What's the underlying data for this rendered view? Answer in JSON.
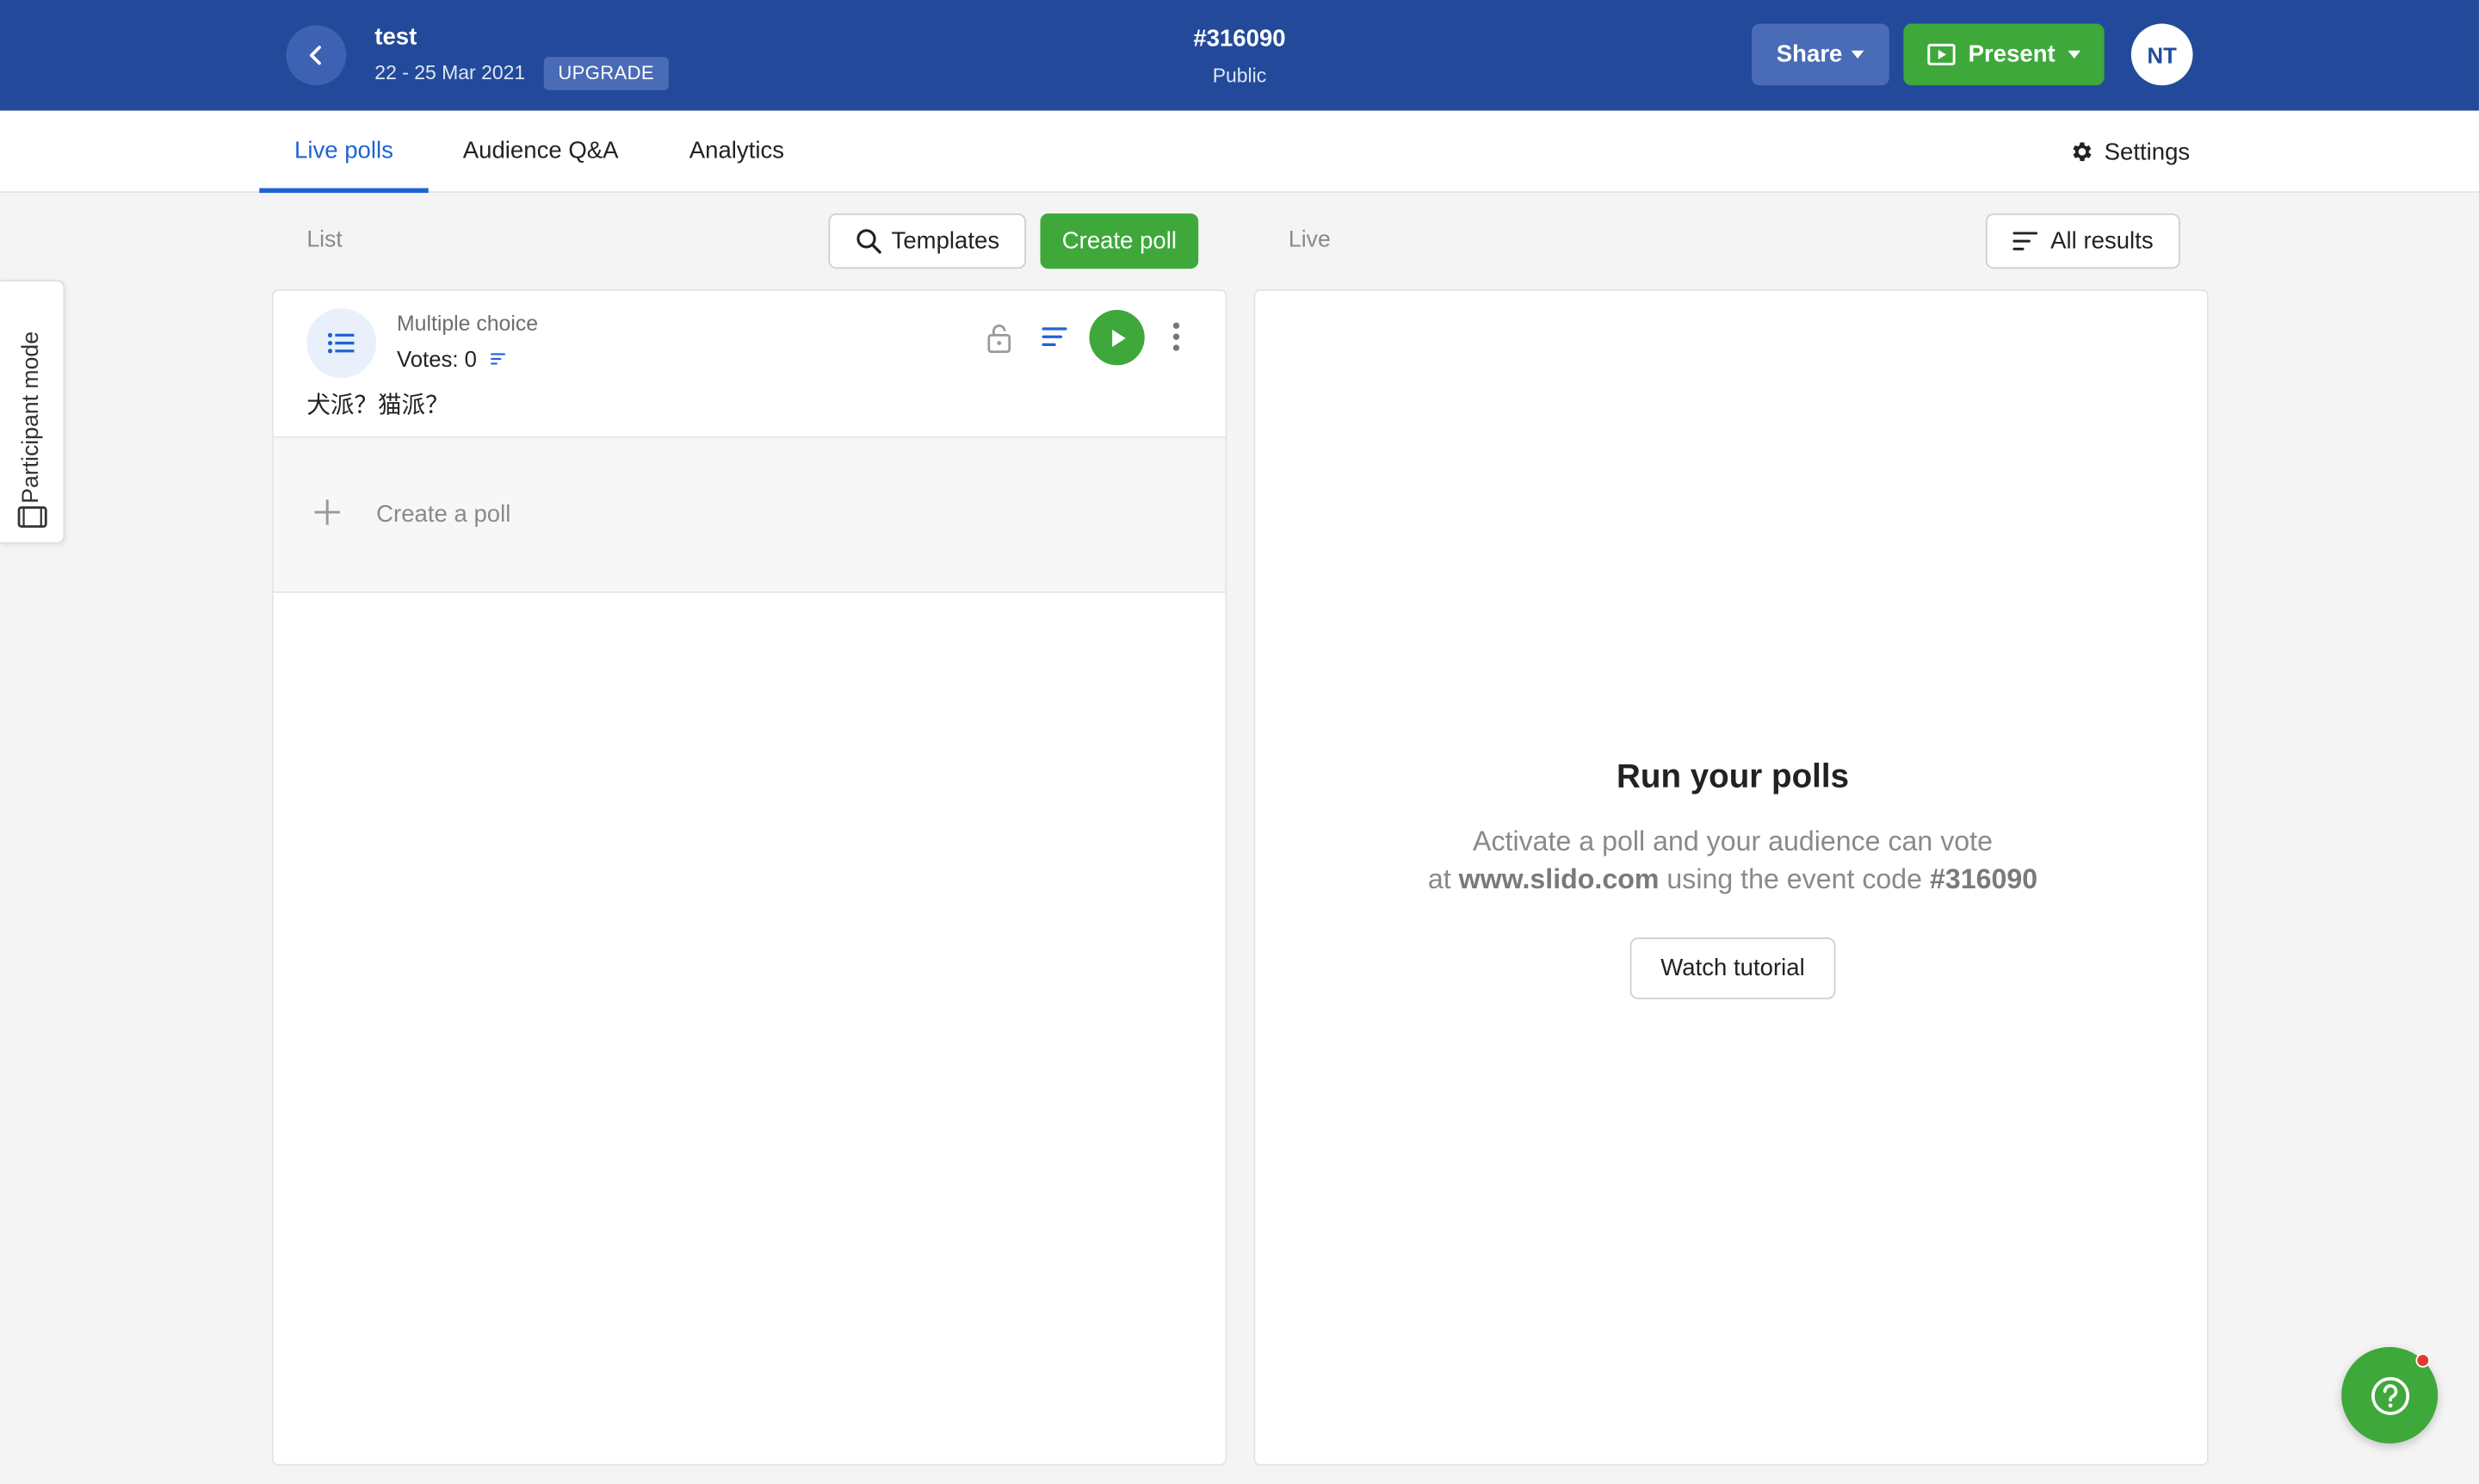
{
  "event": {
    "title": "test",
    "dates": "22 - 25 Mar 2021",
    "upgrade_label": "UPGRADE",
    "code": "#316090",
    "privacy": "Public"
  },
  "header": {
    "share_label": "Share",
    "present_label": "Present",
    "avatar_initials": "NT"
  },
  "tabs": [
    {
      "label": "Live polls",
      "active": true
    },
    {
      "label": "Audience Q&A",
      "active": false
    },
    {
      "label": "Analytics",
      "active": false
    }
  ],
  "settings_label": "Settings",
  "list_panel": {
    "label": "List",
    "templates_label": "Templates",
    "create_poll_label": "Create poll",
    "poll": {
      "type": "Multiple choice",
      "votes": "Votes: 0",
      "question": "犬派？猫派？"
    },
    "create_row_label": "Create a poll"
  },
  "live_panel": {
    "label": "Live",
    "all_results_label": "All results",
    "empty_title": "Run your polls",
    "empty_line1": "Activate a poll and your audience can vote",
    "empty_line2_prefix": "at ",
    "empty_line2_site": "www.slido.com",
    "empty_line2_mid": " using the event code ",
    "empty_line2_code": "#316090",
    "watch_tutorial_label": "Watch tutorial"
  },
  "participant_mode_label": "Participant mode",
  "colors": {
    "header_bg": "#234a9a",
    "accent_blue": "#1f63d6",
    "brand_green": "#3ea83b",
    "notification_red": "#e03a2f"
  },
  "icons": [
    "chevron-left-icon",
    "present-screen-icon",
    "gear-icon",
    "search-icon",
    "filter-lines-icon",
    "list-icon",
    "lock-icon",
    "results-icon",
    "play-icon",
    "more-vertical-icon",
    "plus-icon",
    "participant-screen-icon",
    "help-question-icon"
  ]
}
